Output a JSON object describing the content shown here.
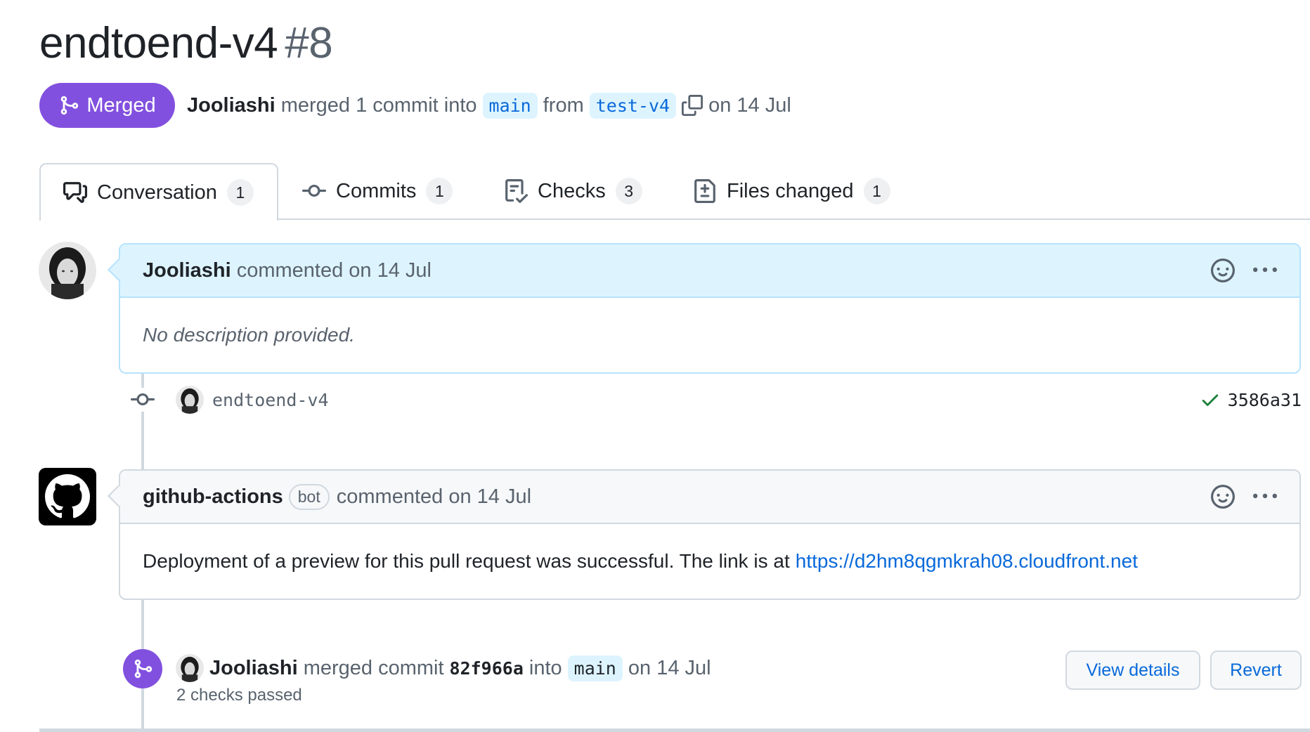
{
  "pr": {
    "title": "endtoend-v4",
    "number": "#8"
  },
  "status": {
    "badge_label": "Merged",
    "author": "Jooliashi",
    "action": "merged 1 commit into",
    "base_branch": "main",
    "from_word": "from",
    "head_branch": "test-v4",
    "date_text": "on 14 Jul"
  },
  "tabs": [
    {
      "label": "Conversation",
      "count": "1",
      "icon": "comment-discussion-icon"
    },
    {
      "label": "Commits",
      "count": "1",
      "icon": "git-commit-icon"
    },
    {
      "label": "Checks",
      "count": "3",
      "icon": "checklist-icon"
    },
    {
      "label": "Files changed",
      "count": "1",
      "icon": "file-diff-icon"
    }
  ],
  "comment1": {
    "author": "Jooliashi",
    "meta": "commented on 14 Jul",
    "body": "No description provided."
  },
  "commit": {
    "message": "endtoend-v4",
    "sha": "3586a31",
    "status": "success"
  },
  "comment2": {
    "author": "github-actions",
    "bot_label": "bot",
    "meta": "commented on 14 Jul",
    "body_text": "Deployment of a preview for this pull request was successful. The link is at",
    "link": "https://d2hm8qgmkrah08.cloudfront.net"
  },
  "merge_event": {
    "author": "Jooliashi",
    "action": "merged commit",
    "sha": "82f966a",
    "into_word": "into",
    "branch": "main",
    "date_text": "on 14 Jul",
    "checks": "2 checks passed",
    "view_details_label": "View details",
    "revert_label": "Revert"
  },
  "colors": {
    "merged": "#8250df",
    "link": "#0969da",
    "success": "#1a7f37",
    "border": "#d1d9e0",
    "author_header": "#ddf4ff"
  }
}
